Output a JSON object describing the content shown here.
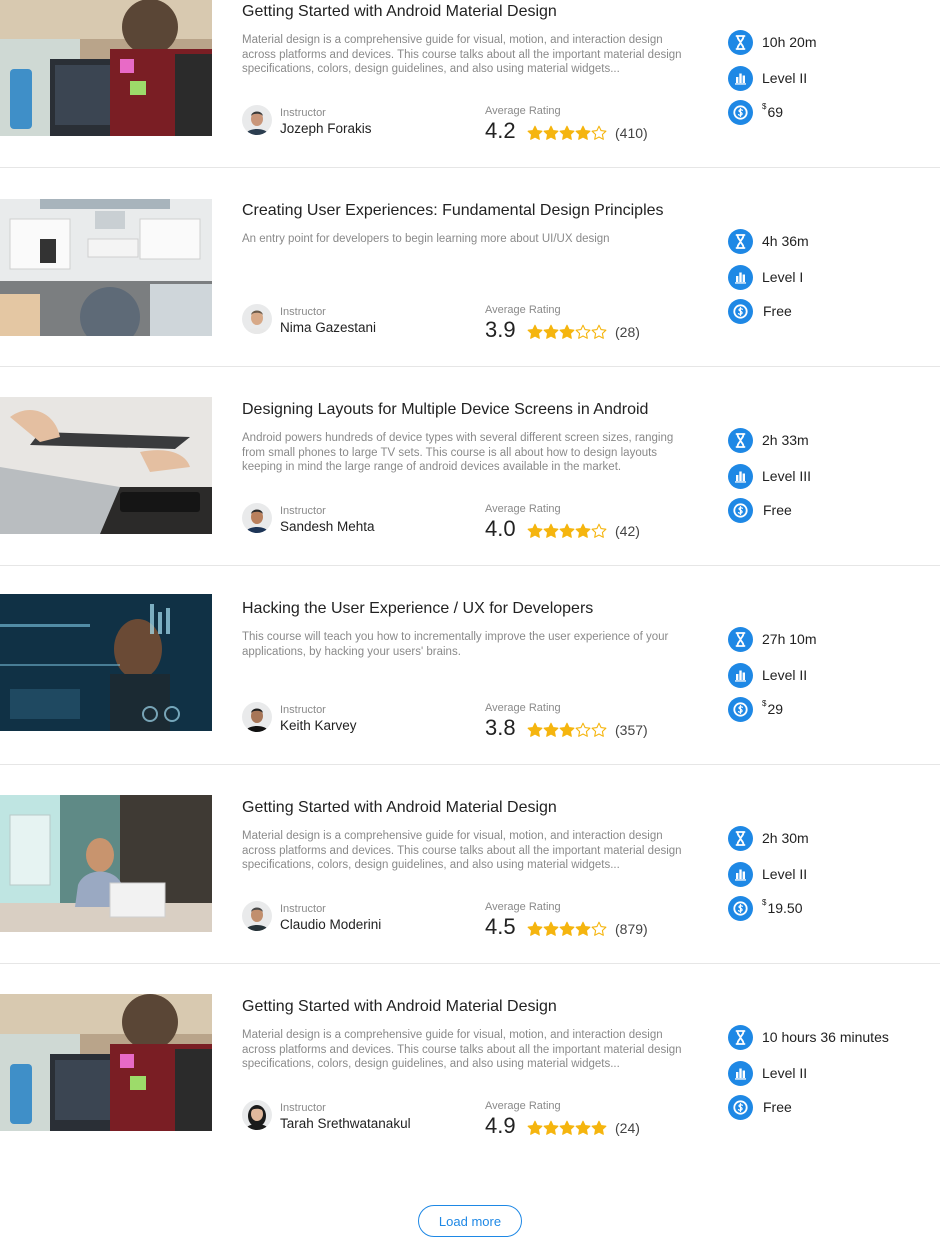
{
  "colors": {
    "accent": "#1e88e5",
    "star": "#f5b50f",
    "divider": "#e6e6e6"
  },
  "labels": {
    "instructor": "Instructor",
    "average_rating": "Average Rating"
  },
  "courses": [
    {
      "title": "Getting Started with Android Material Design",
      "description": "Material design is a comprehensive guide for visual, motion, and interaction design across platforms and devices. This course talks about all the important material design specifications, colors, design guidelines, and also using material widgets...",
      "instructor": "Jozeph Forakis",
      "rating": "4.2",
      "rating_stars": 4.2,
      "rating_count": "(410)",
      "duration": "10h 20m",
      "level": "Level II",
      "price_symbol": "$",
      "price": "69",
      "thumbnail": "developer-at-laptop-photo",
      "icons": {
        "duration": "hourglass-icon",
        "level": "bar-chart-icon",
        "price": "dollar-icon"
      }
    },
    {
      "title": "Creating User Experiences: Fundamental Design Principles",
      "description": "An entry point for developers to begin learning more about UI/UX design",
      "instructor": "Nima Gazestani",
      "rating": "3.9",
      "rating_stars": 3.0,
      "rating_count": "(28)",
      "duration": "4h 36m",
      "level": "Level I",
      "price_symbol": "",
      "price": "Free",
      "thumbnail": "desk-top-view-photo",
      "icons": {
        "duration": "hourglass-icon",
        "level": "bar-chart-icon",
        "price": "dollar-icon"
      }
    },
    {
      "title": "Designing Layouts for Multiple Device Screens in Android",
      "description": "Android powers hundreds of device types with several different screen sizes, ranging from small phones to large TV sets. This course is all about how to design layouts keeping in mind the large range of android devices available in the market.",
      "instructor": "Sandesh Mehta",
      "rating": "4.0",
      "rating_stars": 4.0,
      "rating_count": "(42)",
      "duration": "2h 33m",
      "level": "Level III",
      "price_symbol": "",
      "price": "Free",
      "thumbnail": "tablet-and-laptop-photo",
      "icons": {
        "duration": "hourglass-icon",
        "level": "bar-chart-icon",
        "price": "dollar-icon"
      }
    },
    {
      "title": "Hacking the User Experience / UX for Developers",
      "description": "This course will teach you how to incrementally improve the user experience of your applications, by hacking your users' brains.",
      "instructor": "Keith Karvey",
      "rating": "3.8",
      "rating_stars": 3.0,
      "rating_count": "(357)",
      "duration": "27h 10m",
      "level": "Level II",
      "price_symbol": "$",
      "price": "29",
      "thumbnail": "hacker-screen-photo",
      "icons": {
        "duration": "hourglass-icon",
        "level": "bar-chart-icon",
        "price": "dollar-icon"
      }
    },
    {
      "title": "Getting Started with Android Material Design",
      "description": "Material design is a comprehensive guide for visual, motion, and interaction design across platforms and devices. This course talks about all the important material design specifications, colors, design guidelines, and also using material widgets...",
      "instructor": "Claudio Moderini",
      "rating": "4.5",
      "rating_stars": 4.0,
      "rating_count": "(879)",
      "duration": "2h 30m",
      "level": "Level II",
      "price_symbol": "$",
      "price": "19.50",
      "thumbnail": "man-on-phone-photo",
      "icons": {
        "duration": "hourglass-icon",
        "level": "bar-chart-icon",
        "price": "dollar-icon"
      }
    },
    {
      "title": "Getting Started with Android Material Design",
      "description": "Material design is a comprehensive guide for visual, motion, and interaction design across platforms and devices. This course talks about all the important material design specifications, colors, design guidelines, and also using material widgets...",
      "instructor": "Tarah Srethwatanakul",
      "rating": "4.9",
      "rating_stars": 5.0,
      "rating_count": "(24)",
      "duration": "10 hours 36 minutes",
      "level": "Level II",
      "price_symbol": "",
      "price": "Free",
      "thumbnail": "developer-at-laptop-photo",
      "icons": {
        "duration": "hourglass-icon",
        "level": "bar-chart-icon",
        "price": "dollar-icon"
      }
    }
  ],
  "load_more": "Load more"
}
